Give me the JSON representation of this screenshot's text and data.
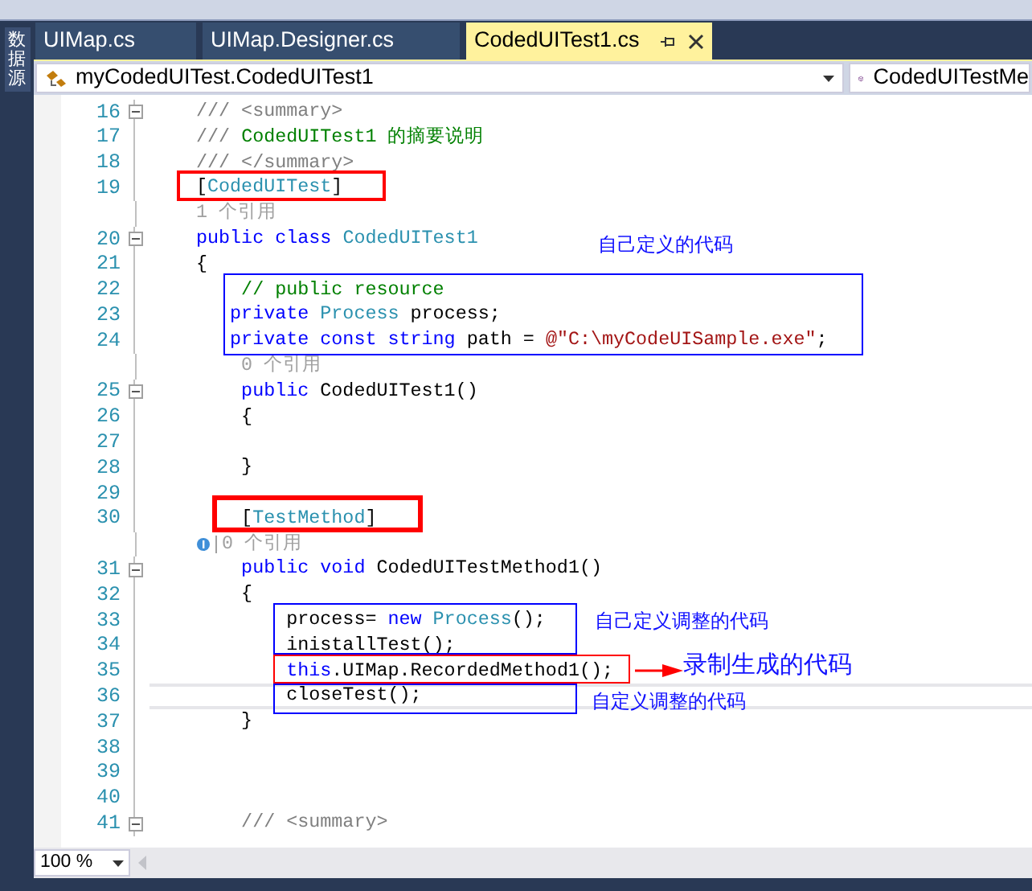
{
  "side_panel": {
    "label": "数据源"
  },
  "tabs": [
    {
      "label": "UIMap.cs",
      "selected": false
    },
    {
      "label": "UIMap.Designer.cs",
      "selected": false
    },
    {
      "label": "CodedUITest1.cs",
      "selected": true
    }
  ],
  "nav": {
    "type_dropdown": "myCodedUITest.CodedUITest1",
    "member_dropdown": "CodedUITestMe"
  },
  "lines": [
    {
      "kind": "code",
      "number": "16",
      "fold": true,
      "current": false,
      "tokens": [
        {
          "text": "/// <summary>",
          "kind": "doc"
        }
      ]
    },
    {
      "kind": "code",
      "number": "17",
      "fold": false,
      "current": false,
      "tokens": [
        {
          "text": "/// ",
          "kind": "doc"
        },
        {
          "text": "CodedUITest1 的摘要说明",
          "kind": "comment"
        }
      ]
    },
    {
      "kind": "code",
      "number": "18",
      "fold": false,
      "current": false,
      "tokens": [
        {
          "text": "/// </summary>",
          "kind": "doc"
        }
      ]
    },
    {
      "kind": "code",
      "number": "19",
      "fold": false,
      "current": false,
      "tokens": [
        {
          "text": "[",
          "kind": "plain"
        },
        {
          "text": "CodedUITest",
          "kind": "type"
        },
        {
          "text": "]",
          "kind": "plain"
        }
      ]
    },
    {
      "kind": "codelens",
      "text": "1 个引用"
    },
    {
      "kind": "code",
      "number": "20",
      "fold": true,
      "current": false,
      "tokens": [
        {
          "text": "public class ",
          "kind": "keyword"
        },
        {
          "text": "CodedUITest1",
          "kind": "type"
        }
      ]
    },
    {
      "kind": "code",
      "number": "21",
      "fold": false,
      "current": false,
      "tokens": [
        {
          "text": "{",
          "kind": "plain"
        }
      ]
    },
    {
      "kind": "code",
      "number": "22",
      "fold": false,
      "current": false,
      "tokens": [
        {
          "text": "    // public resource",
          "kind": "comment"
        }
      ]
    },
    {
      "kind": "code",
      "number": "23",
      "fold": false,
      "current": false,
      "tokens": [
        {
          "text": "   private ",
          "kind": "keyword"
        },
        {
          "text": "Process",
          "kind": "type"
        },
        {
          "text": " process;",
          "kind": "plain"
        }
      ]
    },
    {
      "kind": "code",
      "number": "24",
      "fold": false,
      "current": false,
      "tokens": [
        {
          "text": "   private const string ",
          "kind": "keyword"
        },
        {
          "text": "path = ",
          "kind": "plain"
        },
        {
          "text": "@\"C:\\myCodeUISample.exe\"",
          "kind": "string"
        },
        {
          "text": ";",
          "kind": "plain"
        }
      ]
    },
    {
      "kind": "codelens",
      "text": "    0 个引用"
    },
    {
      "kind": "code",
      "number": "25",
      "fold": true,
      "current": false,
      "tokens": [
        {
          "text": "    public ",
          "kind": "keyword"
        },
        {
          "text": "CodedUITest1()",
          "kind": "plain"
        }
      ]
    },
    {
      "kind": "code",
      "number": "26",
      "fold": false,
      "current": false,
      "tokens": [
        {
          "text": "    {",
          "kind": "plain"
        }
      ]
    },
    {
      "kind": "code",
      "number": "27",
      "fold": false,
      "current": false
    },
    {
      "kind": "code",
      "number": "28",
      "fold": false,
      "current": false,
      "tokens": [
        {
          "text": "    }",
          "kind": "plain"
        }
      ]
    },
    {
      "kind": "code",
      "number": "29",
      "fold": false,
      "current": false
    },
    {
      "kind": "code",
      "number": "30",
      "fold": false,
      "current": false,
      "tokens": [
        {
          "text": "    [",
          "kind": "plain"
        },
        {
          "text": "TestMethod",
          "kind": "type"
        },
        {
          "text": "]",
          "kind": "plain"
        }
      ]
    },
    {
      "kind": "codelens-test",
      "text": "0 个引用"
    },
    {
      "kind": "code",
      "number": "31",
      "fold": true,
      "current": false,
      "tokens": [
        {
          "text": "    public void ",
          "kind": "keyword"
        },
        {
          "text": "CodedUITestMethod1()",
          "kind": "plain"
        }
      ]
    },
    {
      "kind": "code",
      "number": "32",
      "fold": false,
      "current": false,
      "tokens": [
        {
          "text": "    {",
          "kind": "plain"
        }
      ]
    },
    {
      "kind": "code",
      "number": "33",
      "fold": false,
      "current": false,
      "tokens": [
        {
          "text": "        process= ",
          "kind": "plain"
        },
        {
          "text": "new ",
          "kind": "keyword"
        },
        {
          "text": "Process",
          "kind": "type"
        },
        {
          "text": "();",
          "kind": "plain"
        }
      ]
    },
    {
      "kind": "code",
      "number": "34",
      "fold": false,
      "current": false,
      "tokens": [
        {
          "text": "        inistallTest();",
          "kind": "plain"
        }
      ]
    },
    {
      "kind": "code",
      "number": "35",
      "fold": false,
      "current": false,
      "tokens": [
        {
          "text": "        this",
          "kind": "keyword"
        },
        {
          "text": ".UIMap.RecordedMethod1();",
          "kind": "plain"
        }
      ]
    },
    {
      "kind": "code",
      "number": "36",
      "fold": false,
      "current": true,
      "tokens": [
        {
          "text": "        closeTest();",
          "kind": "plain"
        }
      ]
    },
    {
      "kind": "code",
      "number": "37",
      "fold": false,
      "current": false,
      "tokens": [
        {
          "text": "    }",
          "kind": "plain"
        }
      ]
    },
    {
      "kind": "code",
      "number": "38",
      "fold": false,
      "current": false
    },
    {
      "kind": "code",
      "number": "39",
      "fold": false,
      "current": false
    },
    {
      "kind": "code",
      "number": "40",
      "fold": false,
      "current": false
    },
    {
      "kind": "code",
      "number": "41",
      "fold": true,
      "current": false,
      "tokens": [
        {
          "text": "    /// <summary>",
          "kind": "doc"
        }
      ]
    }
  ],
  "annotations": [
    {
      "kind": "box",
      "color": "#ff0000"
    },
    {
      "kind": "box",
      "color": "#0000ff"
    },
    {
      "kind": "note",
      "text": "自己定义的代码"
    },
    {
      "kind": "box",
      "color": "#ff0000"
    },
    {
      "kind": "box",
      "color": "#0000ff"
    },
    {
      "kind": "note",
      "text": "自己定义调整的代码"
    },
    {
      "kind": "box",
      "color": "#ff0000"
    },
    {
      "kind": "arrow",
      "color": "#ff0000"
    },
    {
      "kind": "note",
      "text": "录制生成的代码"
    },
    {
      "kind": "box",
      "color": "#0000ff"
    },
    {
      "kind": "note",
      "text": "自定义调整的代码"
    }
  ],
  "zoom": "100 %"
}
